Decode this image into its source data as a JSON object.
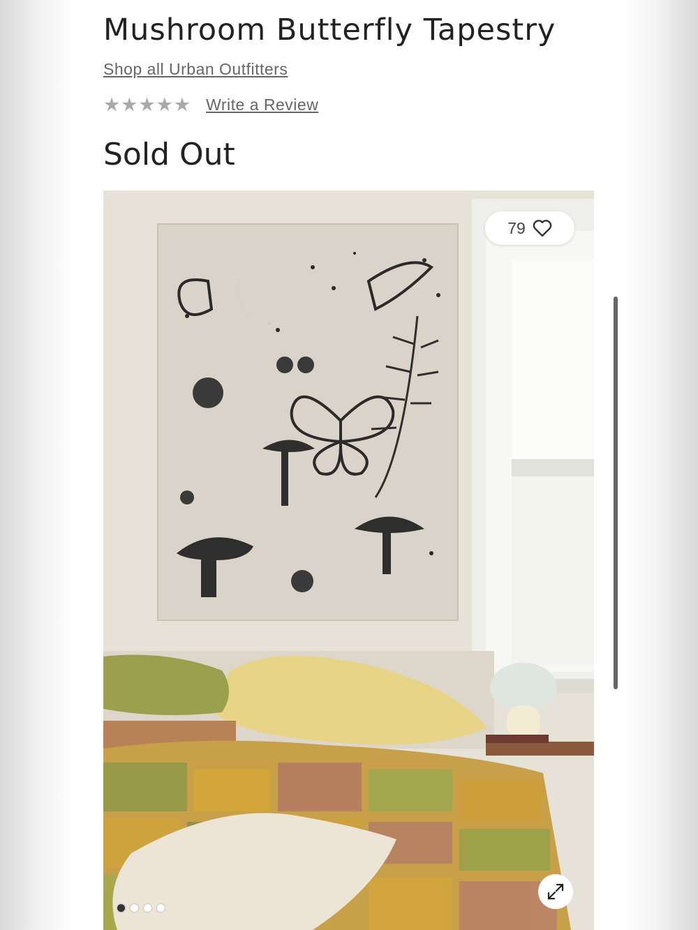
{
  "product": {
    "title": "Mushroom Butterfly Tapestry",
    "shop_link": "Shop all Urban Outfitters",
    "rating_stars": 0,
    "review_link": "Write a Review",
    "status": "Sold Out"
  },
  "gallery": {
    "favorites_count": "79",
    "image_count": 4,
    "active_image": 1
  },
  "icons": {
    "heart": "heart-icon",
    "expand": "expand-icon",
    "star": "star-icon"
  },
  "colors": {
    "text": "#222222",
    "link": "#666666",
    "star_empty": "#a9a9a9",
    "scrollbar": "#666666"
  }
}
